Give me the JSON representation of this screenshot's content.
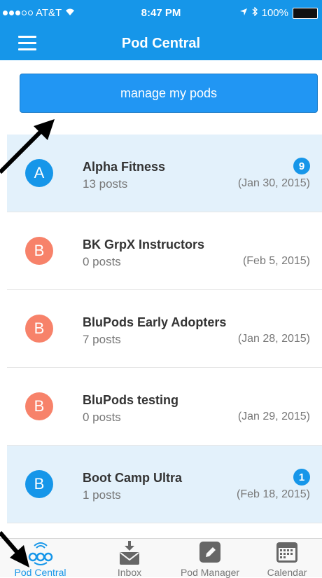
{
  "status_bar": {
    "carrier": "AT&T",
    "time": "8:47 PM",
    "battery": "100%"
  },
  "header": {
    "title": "Pod Central",
    "menu_icon": "menu-icon"
  },
  "manage_button": {
    "label": "manage my pods"
  },
  "pods": [
    {
      "initial": "A",
      "name": "Alpha Fitness",
      "posts": "13 posts",
      "date": "(Jan 30, 2015)",
      "badge": "9"
    },
    {
      "initial": "B",
      "name": "BK GrpX Instructors",
      "posts": "0 posts",
      "date": "(Feb 5, 2015)",
      "badge": ""
    },
    {
      "initial": "B",
      "name": "BluPods Early Adopters",
      "posts": "7 posts",
      "date": "(Jan 28, 2015)",
      "badge": ""
    },
    {
      "initial": "B",
      "name": "BluPods testing",
      "posts": "0 posts",
      "date": "(Jan 29, 2015)",
      "badge": ""
    },
    {
      "initial": "B",
      "name": "Boot Camp Ultra",
      "posts": "1 posts",
      "date": "(Feb 18, 2015)",
      "badge": "1"
    }
  ],
  "tabs": [
    {
      "label": "Pod Central",
      "icon": "pod-central-icon"
    },
    {
      "label": "Inbox",
      "icon": "inbox-icon"
    },
    {
      "label": "Pod Manager",
      "icon": "edit-icon"
    },
    {
      "label": "Calendar",
      "icon": "calendar-icon"
    }
  ],
  "colors": {
    "primary": "#1696e9",
    "avatar_blue": "#1696e9",
    "avatar_orange": "#f7826a",
    "unread_row": "#e3f1fb"
  }
}
